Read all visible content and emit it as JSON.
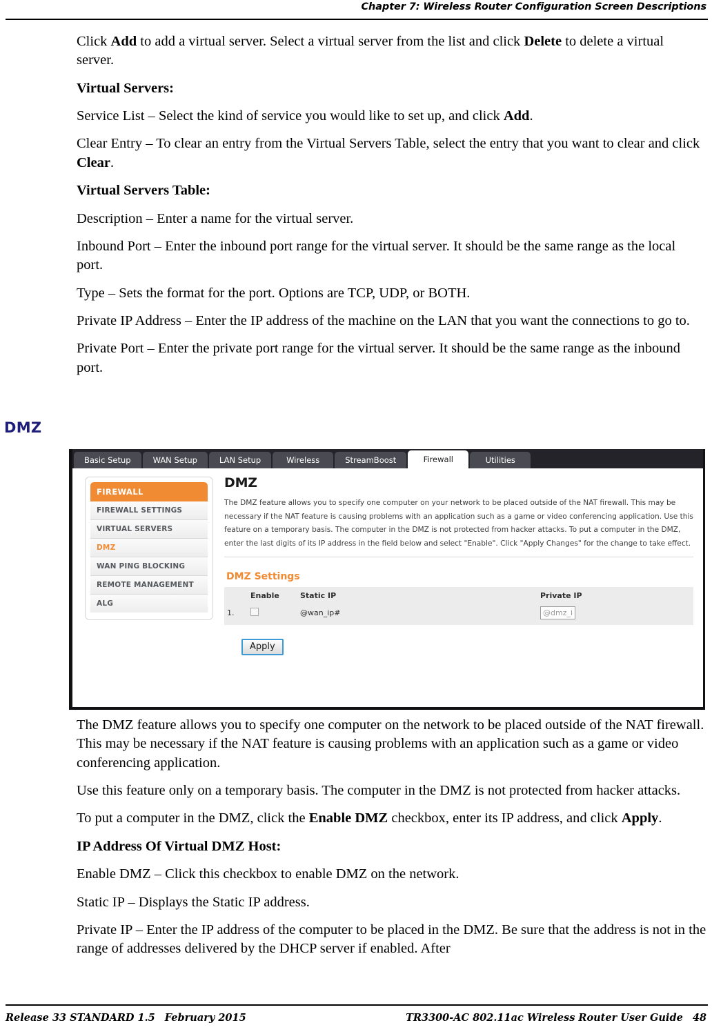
{
  "header": {
    "chapter_title": "Chapter 7: Wireless Router Configuration Screen Descriptions"
  },
  "body_top": {
    "p1_a": "Click ",
    "p1_b1": "Add",
    "p1_c": " to add a virtual server.  Select a virtual server from the list and click ",
    "p1_b2": "Delete",
    "p1_d": " to delete a virtual server.",
    "h_virtual_servers": "Virtual Servers:",
    "p2_a": "Service List – Select the kind of service you would like to set up, and click ",
    "p2_b": "Add",
    "p2_c": ".",
    "p3_a": "Clear Entry – To clear an entry from the Virtual Servers Table, select the entry that you want to clear and click ",
    "p3_b": "Clear",
    "p3_c": ".",
    "h_virtual_servers_table": "Virtual Servers Table:",
    "p4": "Description – Enter a name for the virtual server.",
    "p5": "Inbound Port – Enter the inbound port range for the virtual server.  It should be the same range as the local port.",
    "p6": "Type – Sets the format for the port.  Options are TCP, UDP, or BOTH.",
    "p7": "Private IP Address – Enter the IP address of the machine on the LAN that you want the connections to go to.",
    "p8": "Private Port – Enter the private port range for the virtual server.  It should be the same range as the inbound port."
  },
  "section": {
    "heading": "DMZ",
    "heading_color": "#1f1f7a"
  },
  "screenshot": {
    "tabs": [
      {
        "label": "Basic Setup",
        "active": false
      },
      {
        "label": "WAN Setup",
        "active": false
      },
      {
        "label": "LAN Setup",
        "active": false
      },
      {
        "label": "Wireless",
        "active": false
      },
      {
        "label": "StreamBoost",
        "active": false
      },
      {
        "label": "Firewall",
        "active": true
      },
      {
        "label": "Utilities",
        "active": false
      }
    ],
    "sidebar": {
      "header": "FIREWALL",
      "items": [
        {
          "label": "FIREWALL SETTINGS",
          "selected": false
        },
        {
          "label": "VIRTUAL SERVERS",
          "selected": false
        },
        {
          "label": "DMZ",
          "selected": true
        },
        {
          "label": "WAN PING BLOCKING",
          "selected": false
        },
        {
          "label": "REMOTE MANAGEMENT",
          "selected": false
        },
        {
          "label": "ALG",
          "selected": false
        }
      ]
    },
    "panel": {
      "title": "DMZ",
      "description": "The DMZ feature allows you to specify one computer on your network to be placed outside of the NAT firewall. This may be necessary if the NAT feature is causing problems with an application such as a game or video conferencing application. Use this feature on a temporary basis. The computer in the DMZ is not protected from hacker attacks. To put a computer in the DMZ, enter the last digits of its IP address in the field below and select \"Enable\". Click \"Apply Changes\" for the change to take effect.",
      "settings_title": "DMZ Settings",
      "table": {
        "headers": [
          "",
          "Enable",
          "Static IP",
          "Private IP"
        ],
        "rows": [
          {
            "index": "1.",
            "enable_checked": false,
            "static_ip": "@wan_ip#",
            "private_ip_value": "@dmz_i"
          }
        ]
      },
      "apply_label": "Apply"
    },
    "accent_orange": "#f18b33",
    "tabbar_bg": "#232329",
    "tab_bg": "#4a4a52"
  },
  "body_bottom": {
    "p1": "The DMZ feature allows you to specify one computer on the network to be placed outside of the NAT firewall.  This may be necessary if the NAT feature is causing problems with an application such as a game or video conferencing application.",
    "p2": "Use this feature only on a temporary basis.  The computer in the DMZ is not protected from hacker attacks.",
    "p3_a": "To put a computer in the DMZ, click the ",
    "p3_b1": "Enable DMZ",
    "p3_c": " checkbox, enter its IP address, and click ",
    "p3_b2": "Apply",
    "p3_d": ".",
    "h_ip_address": "IP Address Of Virtual DMZ Host:",
    "p4": "Enable DMZ – Click this checkbox to enable DMZ on the network.",
    "p5": "Static IP – Displays the Static IP address.",
    "p6": "Private IP – Enter the IP address of the computer to be placed in the DMZ.  Be sure that the address is not in the range of addresses delivered by the DHCP server if enabled.  After"
  },
  "footer": {
    "release": "Release 33 STANDARD 1.5",
    "date": "February 2015",
    "guide": "TR3300-AC 802.11ac Wireless Router User Guide",
    "page_number": "48"
  }
}
